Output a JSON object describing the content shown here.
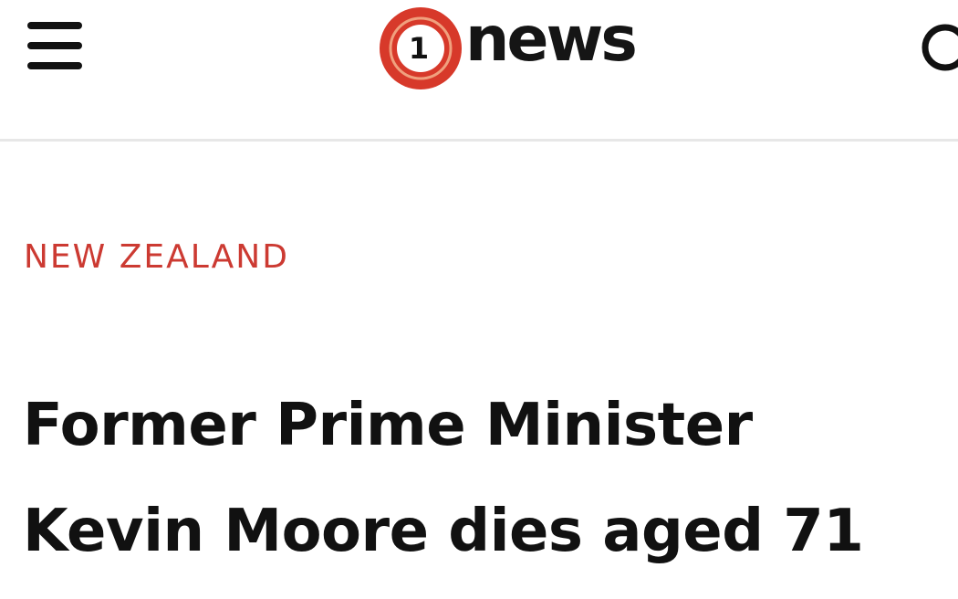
{
  "header": {
    "menu_icon": "hamburger-menu-icon",
    "logo": {
      "mark_icon": "1-circle-logo-icon",
      "mark_text": "1",
      "wordmark": "news",
      "brand_color": "#d7392a"
    },
    "search_icon": "search-icon"
  },
  "article": {
    "category": "NEW ZEALAND",
    "category_color": "#cc3a32",
    "headline_lines": [
      "Former Prime Minister",
      "Kevin Moore dies aged 71"
    ]
  }
}
